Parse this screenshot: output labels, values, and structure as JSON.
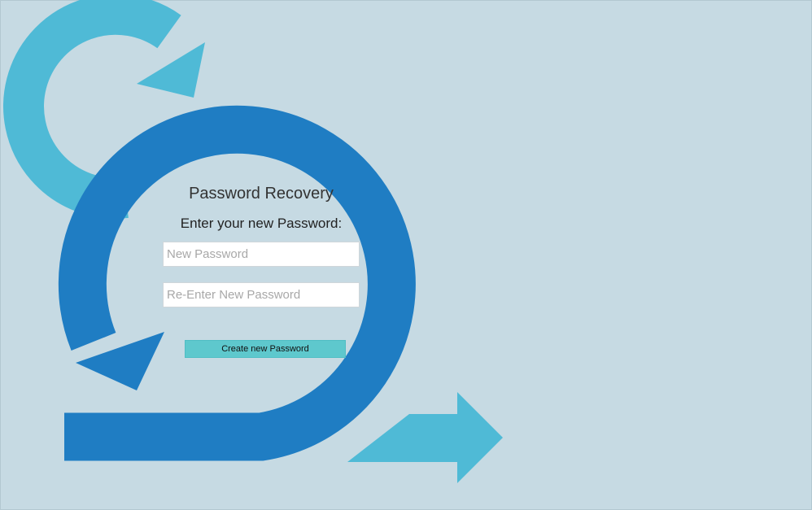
{
  "form": {
    "title": "Password Recovery",
    "instruction": "Enter your new Password:",
    "new_password_placeholder": "New Password",
    "reenter_password_placeholder": "Re-Enter New Password",
    "submit_label": "Create new Password"
  },
  "colors": {
    "background": "#c6dae3",
    "light_arrow": "#4fbad6",
    "dark_arrow": "#1f7dc3",
    "button": "#5ec8cd"
  },
  "icons": [
    "refresh-arrow-icon",
    "cycle-arrow-icon",
    "right-arrow-icon"
  ]
}
